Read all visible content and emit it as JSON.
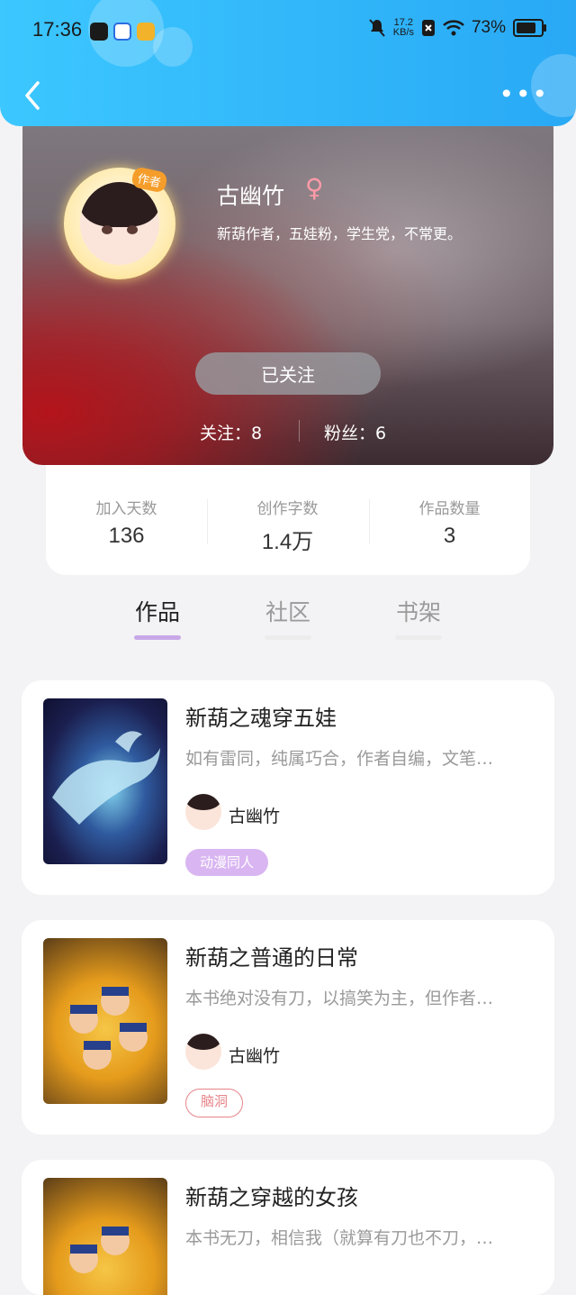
{
  "status_bar": {
    "time": "17:36",
    "net_speed_value": "17.2",
    "net_speed_unit": "KB/s",
    "battery": "73%"
  },
  "profile": {
    "name": "古幽竹",
    "gender_symbol": "♀",
    "bio": "新葫作者，五娃粉，学生党，不常更。",
    "avatar_badge": "作者",
    "follow_button": "已关注",
    "following": "关注：8",
    "fans": "粉丝：6"
  },
  "stats": [
    {
      "label": "加入天数",
      "value": "136"
    },
    {
      "label": "创作字数",
      "value": "1.4万"
    },
    {
      "label": "作品数量",
      "value": "3"
    }
  ],
  "tabs": [
    {
      "label": "作品",
      "active": true
    },
    {
      "label": "社区",
      "active": false
    },
    {
      "label": "书架",
      "active": false
    }
  ],
  "works": [
    {
      "title": "新葫之魂穿五娃",
      "desc": "如有雷同，纯属巧合，作者自编，文笔…",
      "author": "古幽竹",
      "tag": "动漫同人"
    },
    {
      "title": "新葫之普通的日常",
      "desc": "本书绝对没有刀，以搞笑为主，但作者…",
      "author": "古幽竹",
      "tag": "脑洞"
    },
    {
      "title": "新葫之穿越的女孩",
      "desc": "本书无刀，相信我（就算有刀也不刀，…",
      "author": "古幽竹",
      "tag": ""
    }
  ],
  "colors": {
    "header_gradient_start": "#3cc7ff",
    "header_gradient_end": "#29a9f5",
    "tab_active_indicator": "#c9a8e8",
    "tag_fill": "#d9b6f2",
    "tag_outline": "#e7848a"
  }
}
